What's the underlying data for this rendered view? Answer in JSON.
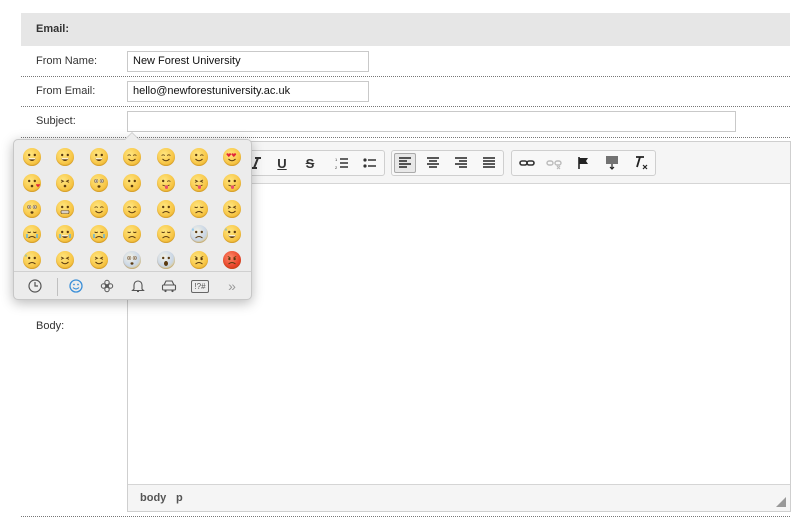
{
  "section": {
    "title": "Email:"
  },
  "fields": {
    "from_name": {
      "label": "From Name:",
      "value": "New Forest University"
    },
    "from_email": {
      "label": "From Email:",
      "value": "hello@newforestuniversity.ac.uk"
    },
    "subject": {
      "label": "Subject:",
      "value": ""
    },
    "body": {
      "label": "Body:"
    }
  },
  "toolbar": {
    "buttons": [
      "italic",
      "underline",
      "strikethrough",
      "numbered-list",
      "bulleted-list",
      "align-left",
      "align-center",
      "align-right",
      "justify",
      "link",
      "unlink",
      "anchor",
      "insert-block",
      "remove-format"
    ],
    "active": "align-left",
    "labels": {
      "underline": "U",
      "strikethrough": "S"
    }
  },
  "footer": {
    "path": [
      "body",
      "p"
    ]
  },
  "emoji_picker": {
    "rows": [
      [
        "grinning",
        "grin",
        "smiley",
        "blush",
        "relaxed",
        "wink",
        "heart-eyes"
      ],
      [
        "kissing-heart",
        "kissing-closed-eyes",
        "flushed",
        "kissing",
        "stuck-out-tongue-winking",
        "stuck-out-tongue-closed-eyes",
        "stuck-out-tongue"
      ],
      [
        "astonished",
        "grimacing",
        "pensive",
        "relieved",
        "unamused",
        "disappointed",
        "persevere"
      ],
      [
        "cry",
        "joy",
        "sob",
        "sleepy",
        "disappointed-relieved",
        "cold-sweat",
        "sweat-smile"
      ],
      [
        "sweat",
        "weary",
        "tired-face",
        "fearful",
        "scream",
        "angry",
        "rage"
      ]
    ],
    "categories": [
      "recent-clock-icon",
      "smileys-icon",
      "flower-icon",
      "bell-icon",
      "car-icon",
      "symbols-icon",
      "more-chevron-icon"
    ],
    "active_category": "smileys-icon",
    "symbols_label": "!?#",
    "more_label": "»"
  },
  "colors": {
    "header_bg": "#e6e6e6",
    "emoji_panel_bg": "#ececec",
    "active_category": "#3b8fd8"
  }
}
